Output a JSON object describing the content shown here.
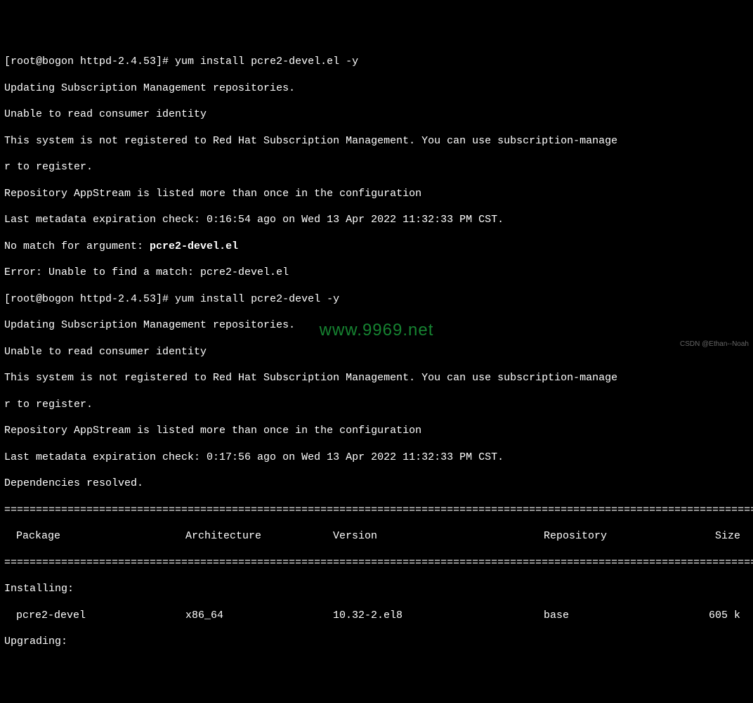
{
  "prompt1_prefix": "[root@bogon httpd-2.4.53]# ",
  "cmd1": "yum install pcre2-devel.el -y",
  "out1_l1": "Updating Subscription Management repositories.",
  "out1_l2": "Unable to read consumer identity",
  "out1_l3a": "This system is not registered to Red Hat Subscription Management. You can use subscription-manage",
  "out1_l3b": "r to register.",
  "out1_l4": "Repository AppStream is listed more than once in the configuration",
  "out1_l5": "Last metadata expiration check: 0:16:54 ago on Wed 13 Apr 2022 11:32:33 PM CST.",
  "out1_l6_pre": "No match for argument: ",
  "out1_l6_bold": "pcre2-devel.el",
  "out1_l7": "Error: Unable to find a match: pcre2-devel.el",
  "prompt2_prefix": "[root@bogon httpd-2.4.53]# ",
  "cmd2": "yum install pcre2-devel -y",
  "out2_l1": "Updating Subscription Management repositories.",
  "out2_l2": "Unable to read consumer identity",
  "out2_l3a": "This system is not registered to Red Hat Subscription Management. You can use subscription-manage",
  "out2_l3b": "r to register.",
  "out2_l4": "Repository AppStream is listed more than once in the configuration",
  "out2_l5": "Last metadata expiration check: 0:17:56 ago on Wed 13 Apr 2022 11:32:33 PM CST.",
  "out2_l6": "Dependencies resolved.",
  "separator": "========================================================================================================================",
  "hdr_pkg": " Package",
  "hdr_arch": "Architecture",
  "hdr_ver": "Version",
  "hdr_repo": "Repository",
  "hdr_size": "Size",
  "installing_label": "Installing:",
  "row1_pkg": " pcre2-devel",
  "row1_arch": "x86_64",
  "row1_ver": "10.32-2.el8",
  "row1_repo": "base",
  "row1_size": "605 k",
  "upgrading_label": "Upgrading:",
  "watermark": "www.9969.net",
  "csdn": "CSDN @Ethan--Noah"
}
